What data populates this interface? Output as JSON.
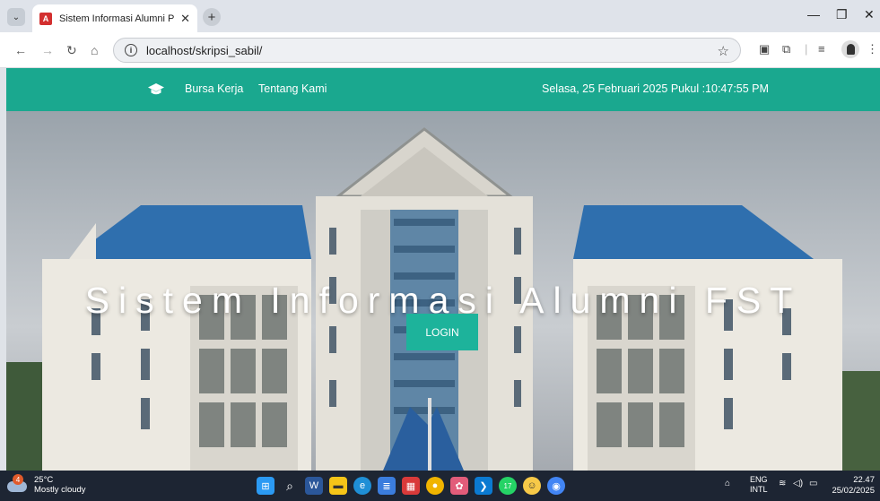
{
  "browser": {
    "tab_title": "Sistem Informasi Alumni Prodi",
    "tab_favicon_letter": "A",
    "url": "localhost/skripsi_sabil/"
  },
  "site": {
    "nav_links": [
      "Bursa Kerja",
      "Tentang Kami"
    ],
    "datetime": "Selasa, 25 Februari 2025 Pukul :10:47:55 PM",
    "hero_title": "Sistem Informasi Alumni FST",
    "login_label": "LOGIN",
    "accent_color": "#1aa88f"
  },
  "taskbar": {
    "weather_badge": "4",
    "temperature": "25°C",
    "weather_desc": "Mostly cloudy",
    "lang_line1": "ENG",
    "lang_line2": "INTL",
    "time": "22.47",
    "date": "25/02/2025",
    "whatsapp_badge": "17"
  }
}
